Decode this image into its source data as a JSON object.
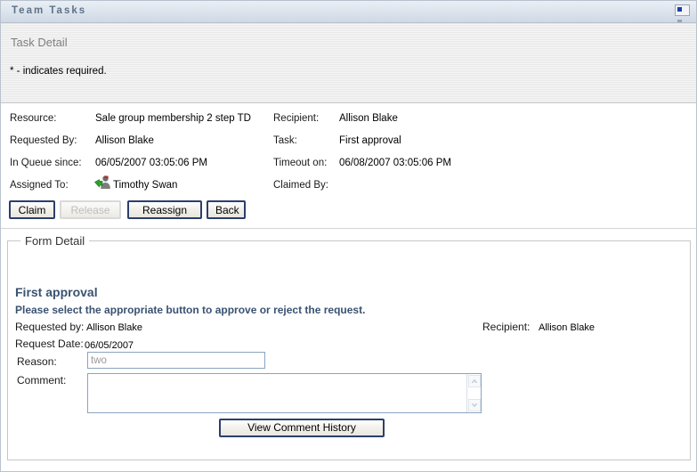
{
  "window": {
    "title": "Team Tasks",
    "restore_icon": "panel-restore-icon"
  },
  "intro": {
    "section_heading": "Task Detail",
    "required_note": "* - indicates required."
  },
  "task_detail": {
    "left_column": [
      {
        "label": "Resource:",
        "value": "Sale group membership 2 step TD"
      },
      {
        "label": "Requested By:",
        "value": "Allison Blake"
      },
      {
        "label": "In Queue since:",
        "value": "06/05/2007 03:05:06 PM"
      },
      {
        "label": "Assigned To:",
        "value": "Timothy Swan"
      }
    ],
    "right_column": [
      {
        "label": "Recipient:",
        "value": "Allison Blake"
      },
      {
        "label": "Task:",
        "value": "First approval"
      },
      {
        "label": "Timeout on:",
        "value": "06/08/2007 03:05:06 PM"
      },
      {
        "label": "Claimed By:",
        "value": ""
      }
    ],
    "assigned_to_icon": "user-assign-icon"
  },
  "actions": {
    "claim": "Claim",
    "release": "Release",
    "release_disabled": true,
    "reassign": "Reassign",
    "back": "Back"
  },
  "form_detail": {
    "legend": "Form Detail",
    "title": "First approval",
    "instruction": "Please select the appropriate button to approve or reject the request.",
    "requested_by_label": "Requested by:",
    "requested_by_value": "Allison Blake",
    "request_date_label": "Request Date:",
    "request_date_value": "06/05/2007",
    "recipient_label": "Recipient:",
    "recipient_value": "Allison Blake",
    "reason_label": "Reason:",
    "reason_value": "two",
    "comment_label": "Comment:",
    "comment_value": "",
    "view_comment_history": "View Comment History"
  },
  "colors": {
    "titlebar_text": "#5f7287",
    "form_heading": "#3a5272",
    "button_border": "#2c3f6b",
    "input_border": "#8aa4bf",
    "disabled_text": "#bdbdbd"
  }
}
